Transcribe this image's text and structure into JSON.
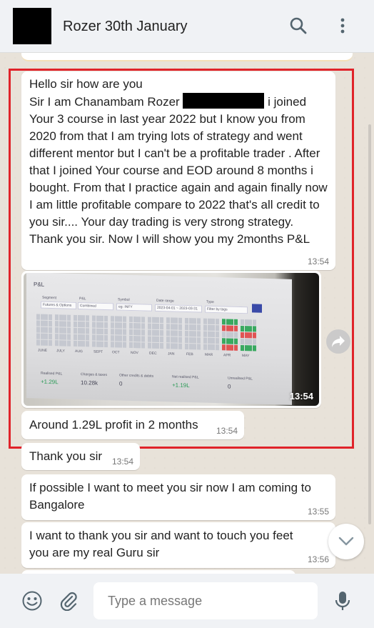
{
  "header": {
    "title": "Rozer 30th January",
    "icons": [
      "search-icon",
      "menu-icon"
    ]
  },
  "messages": [
    {
      "text_before": "Hello sir how are you\nSir I am Chanambam Rozer",
      "text_after": "i joined Your 3 course in last year 2022 but I know you from 2020 from that I am trying lots of strategy and went different mentor but I can't be a profitable trader . After that I joined Your course and EOD around 8 months i bought. From that I practice again and again finally now I am little profitable compare to 2022 that's all credit to you sir.... Your day trading is very strong strategy. Thank you sir. Now I will show you my 2months P&L",
      "time": "13:54"
    },
    {
      "image_time": "13:54"
    },
    {
      "text": "Around 1.29L profit in 2 months",
      "time": "13:54"
    },
    {
      "text": "Thank you sir",
      "time": "13:54"
    },
    {
      "text": "If possible I want to meet you sir now I am coming to Bangalore",
      "time": "13:55"
    },
    {
      "text": "I want to thank you sir and want to touch you feet you are my real Guru sir",
      "time": "13:56"
    }
  ],
  "screenshot_pl": {
    "title": "P&L",
    "filters": [
      "Segment",
      "P&L",
      "Symbol",
      "Date range",
      "Type"
    ],
    "filter_values": [
      "Futures & Options",
      "Combined",
      "eg: INFY",
      "2023-04-01 ~ 2023-03-31",
      "Filter by tags"
    ],
    "months": [
      "JUNE",
      "JULY",
      "AUG",
      "SEPT",
      "OCT",
      "NOV",
      "DEC",
      "JAN",
      "FEB",
      "MAR",
      "APR",
      "MAY"
    ],
    "summary_labels": [
      "Realised P&L",
      "Charges & taxes",
      "Other credits & debits",
      "Net realised P&L",
      "Unrealised P&L"
    ],
    "summary_values": [
      "+1.29L",
      "10.28k",
      "0",
      "+1.19L",
      "0"
    ]
  },
  "footer": {
    "placeholder": "Type a message",
    "icons": [
      "emoji-icon",
      "attach-icon",
      "microphone-icon"
    ]
  },
  "colors": {
    "highlight": "#e0232a",
    "header_bg": "#f0f2f5",
    "bubble_bg": "#ffffff",
    "chat_bg": "#e8e2d9"
  }
}
